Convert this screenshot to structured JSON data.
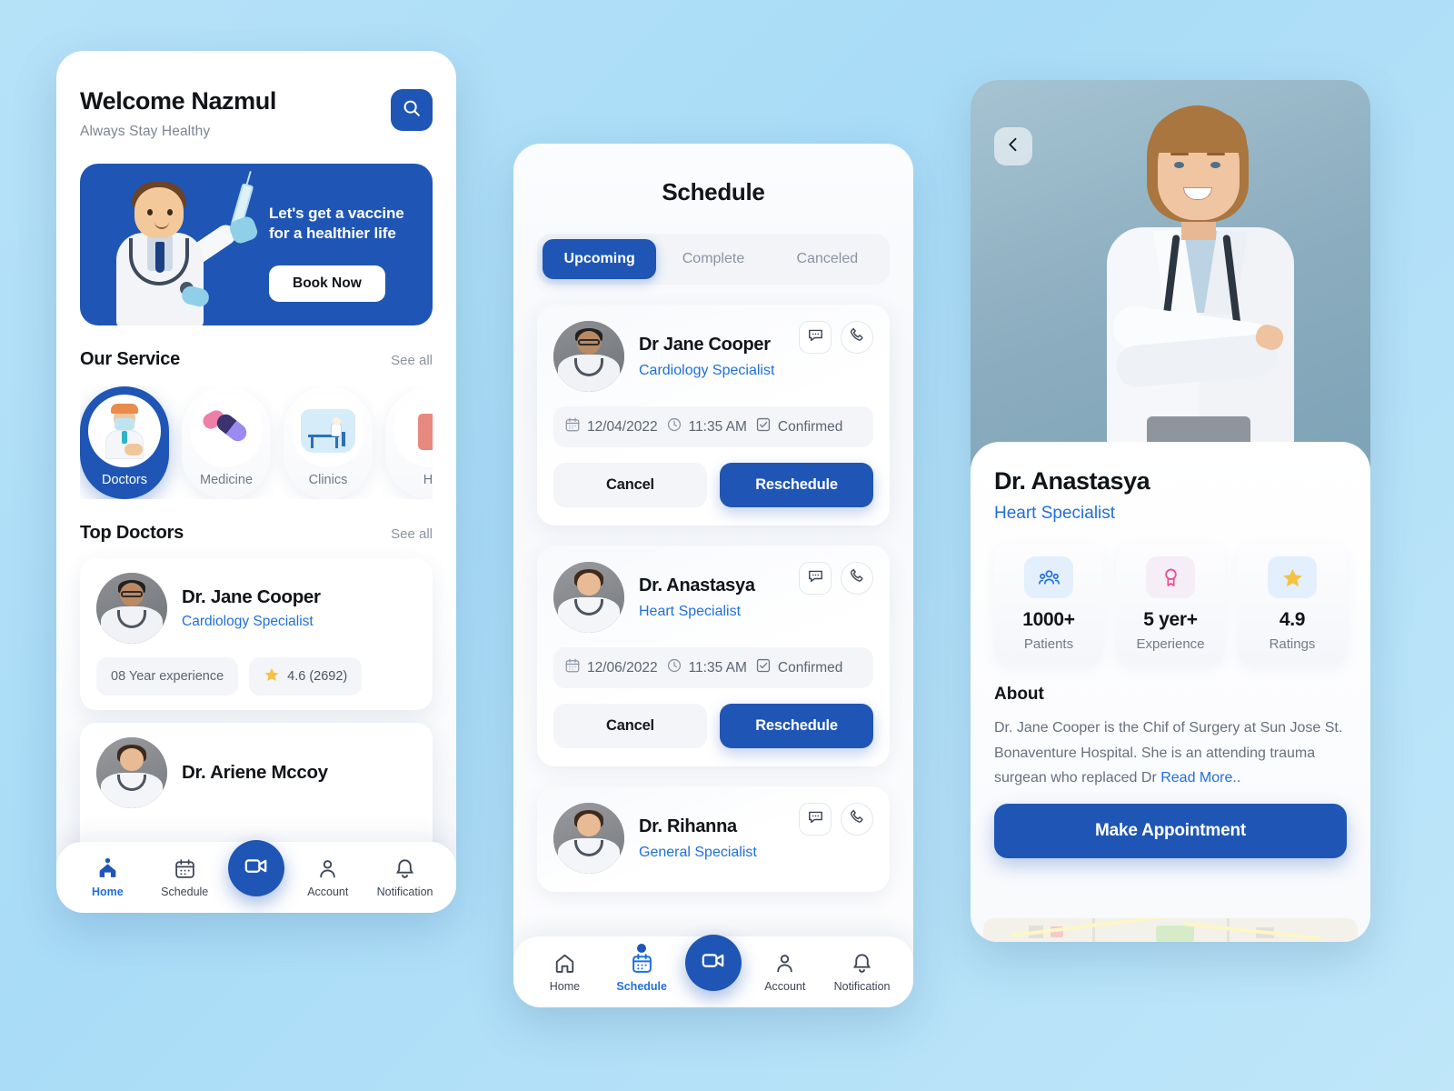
{
  "theme": {
    "accent": "#1f56b5",
    "link": "#1f6fdc",
    "background": "#b0dff7",
    "star": "#f5c243",
    "badge_pink": "#ea4d8f"
  },
  "home": {
    "greeting": "Welcome Nazmul",
    "tagline": "Always Stay Healthy",
    "search_icon": "search-icon",
    "banner": {
      "text": "Let's get a vaccine for a healthier life",
      "button": "Book Now",
      "illustration": "doctor-with-syringe-3d"
    },
    "service_section": {
      "title": "Our Service",
      "see_all": "See all"
    },
    "services": [
      {
        "label": "Doctors",
        "icon": "doctor-icon",
        "active": true
      },
      {
        "label": "Medicine",
        "icon": "pills-icon",
        "active": false
      },
      {
        "label": "Clinics",
        "icon": "clinic-icon",
        "active": false
      },
      {
        "label": "H.",
        "icon": "hospital-icon",
        "active": false
      }
    ],
    "doctors_section": {
      "title": "Top Doctors",
      "see_all": "See all"
    },
    "doctors": [
      {
        "name": "Dr. Jane Cooper",
        "specialty": "Cardiology Specialist",
        "experience": "08 Year experience",
        "rating": "4.6 (2692)",
        "avatar": "male-doctor-photo"
      },
      {
        "name": "Dr. Ariene Mccoy",
        "specialty": "",
        "experience": "",
        "rating": "",
        "avatar": "female-doctor-photo"
      }
    ],
    "nav": [
      {
        "label": "Home",
        "icon": "home-icon",
        "active": true,
        "dot": false
      },
      {
        "label": "Schedule",
        "icon": "calendar-icon",
        "active": false,
        "dot": false
      },
      {
        "label": "",
        "icon": "video-call-icon",
        "active": false,
        "fab": true
      },
      {
        "label": "Account",
        "icon": "user-icon",
        "active": false,
        "dot": false
      },
      {
        "label": "Notification",
        "icon": "bell-icon",
        "active": false,
        "dot": false
      }
    ]
  },
  "schedule": {
    "title": "Schedule",
    "tabs": [
      {
        "label": "Upcoming",
        "active": true
      },
      {
        "label": "Complete",
        "active": false
      },
      {
        "label": "Canceled",
        "active": false
      }
    ],
    "appointments": [
      {
        "name": "Dr Jane Cooper",
        "specialty": "Cardiology Specialist",
        "date": "12/04/2022",
        "time": "11:35 AM",
        "status": "Confirmed",
        "cancel_label": "Cancel",
        "reschedule_label": "Reschedule",
        "avatar": "male-doctor-photo"
      },
      {
        "name": "Dr. Anastasya",
        "specialty": "Heart Specialist",
        "date": "12/06/2022",
        "time": "11:35 AM",
        "status": "Confirmed",
        "cancel_label": "Cancel",
        "reschedule_label": "Reschedule",
        "avatar": "female-doctor-photo"
      },
      {
        "name": "Dr. Rihanna",
        "specialty": "General Specialist",
        "date": "",
        "time": "",
        "status": "",
        "cancel_label": "",
        "reschedule_label": "",
        "avatar": "female-doctor-photo"
      }
    ],
    "nav": [
      {
        "label": "Home",
        "icon": "home-icon",
        "active": false,
        "dot": false
      },
      {
        "label": "Schedule",
        "icon": "calendar-icon",
        "active": true,
        "dot": true
      },
      {
        "label": "",
        "icon": "video-call-icon",
        "active": false,
        "fab": true
      },
      {
        "label": "Account",
        "icon": "user-icon",
        "active": false,
        "dot": false
      },
      {
        "label": "Notification",
        "icon": "bell-icon",
        "active": false,
        "dot": false
      }
    ]
  },
  "profile": {
    "back_icon": "chevron-left-icon",
    "photo": "female-doctor-hero-photo",
    "name": "Dr. Anastasya",
    "specialty": "Heart Specialist",
    "stats": [
      {
        "value": "1000+",
        "label": "Patients",
        "icon": "people-icon"
      },
      {
        "value": "5 yer+",
        "label": "Experience",
        "icon": "award-badge-icon"
      },
      {
        "value": "4.9",
        "label": "Ratings",
        "icon": "star-icon"
      }
    ],
    "about_heading": "About",
    "about_text": "Dr. Jane Cooper is the Chif of Surgery at Sun Jose St. Bonaventure Hospital. She is an attending trauma surgean who replaced Dr",
    "read_more": "Read More..",
    "cta": "Make Appointment",
    "map_preview": "map-thumbnail"
  }
}
